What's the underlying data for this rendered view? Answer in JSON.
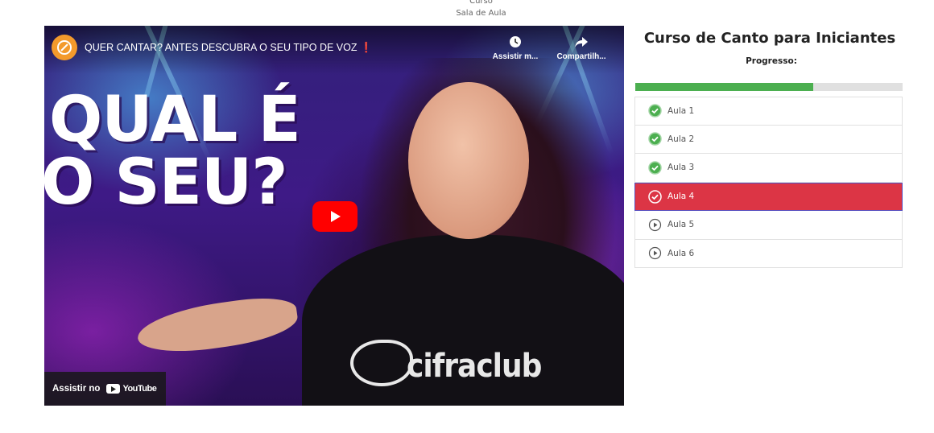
{
  "breadcrumb": [
    "Curso",
    "Sala de Aula"
  ],
  "video": {
    "title": "QUER CANTAR? ANTES DESCUBRA O SEU TIPO DE VOZ ❗",
    "actions": {
      "watch_later": "Assistir m...",
      "share": "Compartilh..."
    },
    "thumbnail_text": [
      "QUAL É",
      "O SEU?"
    ],
    "brand": "cifraclub",
    "watch_on": "Assistir no",
    "platform": "YouTube"
  },
  "course": {
    "title": "Curso de Canto para Iniciantes",
    "progress_label": "Progresso:",
    "progress_fraction": 0.667,
    "colors": {
      "progress": "#4caf50",
      "active": "#dc3545",
      "complete": "#4caf50"
    },
    "lessons": [
      {
        "label": "Aula 1",
        "status": "completed",
        "icon": "check-circle-icon"
      },
      {
        "label": "Aula 2",
        "status": "completed",
        "icon": "check-circle-icon"
      },
      {
        "label": "Aula 3",
        "status": "completed",
        "icon": "check-circle-icon"
      },
      {
        "label": "Aula 4",
        "status": "active",
        "icon": "check-circle-icon"
      },
      {
        "label": "Aula 5",
        "status": "pending",
        "icon": "play-circle-icon"
      },
      {
        "label": "Aula 6",
        "status": "pending",
        "icon": "play-circle-icon"
      }
    ]
  }
}
